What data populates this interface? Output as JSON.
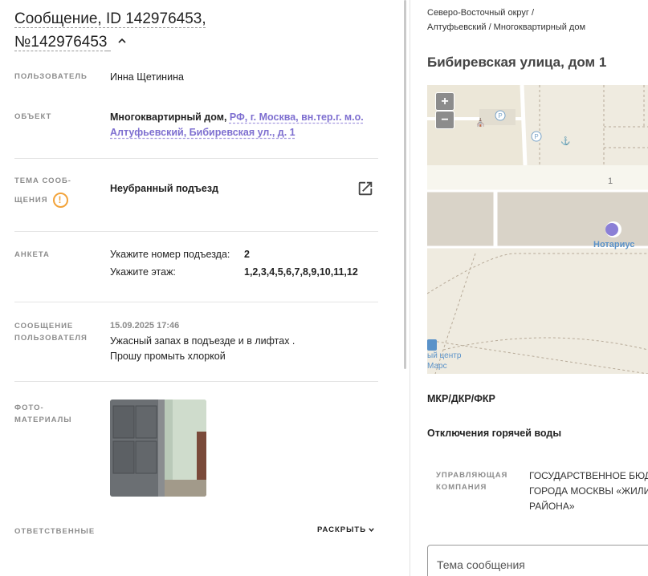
{
  "message": {
    "title_line1": "Сообщение, ID 142976453,",
    "title_line2": "№142976453"
  },
  "fields": {
    "user_label": "ПОЛЬЗОВАТЕЛЬ",
    "user_value": "Инна Щетинина",
    "object_label": "ОБЪЕКТ",
    "object_type": "Многоквартирный дом,",
    "object_link": "РФ, г. Москва, вн.тер.г. м.о. Алтуфьевский, Бибиревская ул., д. 1",
    "topic_label_1": "ТЕМА СООБ-",
    "topic_label_2": "ЩЕНИЯ",
    "topic_value": "Неубранный подъезд",
    "anketa_label": "АНКЕТА",
    "anketa": [
      {
        "q": "Укажите номер подъезда:",
        "a": "2"
      },
      {
        "q": "Укажите этаж:",
        "a": "1,2,3,4,5,6,7,8,9,10,11,12"
      }
    ],
    "user_msg_label_1": "СООБЩЕНИЕ",
    "user_msg_label_2": "ПОЛЬЗОВАТЕЛЯ",
    "user_msg_date": "15.09.2025 17:46",
    "user_msg_line1": "Ужасный запах в подъезде и в лифтах .",
    "user_msg_line2": "Прошу промыть хлоркой",
    "photo_label_1": "ФОТО-",
    "photo_label_2": "МАТЕРИАЛЫ",
    "responsible_label": "ОТВЕТСТВЕННЫЕ",
    "expand_label": "РАСКРЫТЬ"
  },
  "right": {
    "breadcrumb_line1": "Северо-Восточный округ /",
    "breadcrumb_line2": "Алтуфьевский / Многоквартирный дом",
    "address": "Бибиревская улица, дом 1",
    "map": {
      "zoom_in": "+",
      "zoom_out": "−",
      "house_number": "1",
      "poi_notary": "Нотариус",
      "poi_center": "ый центр",
      "poi_mars": "Марс",
      "parking": "P",
      "poi_color": "#8b7fd6"
    },
    "mkr": "МКР/ДКР/ФКР",
    "hot_water": "Отключения горячей воды",
    "uk_label_1": "УПРАВЛЯЮЩАЯ",
    "uk_label_2": "КОМПАНИЯ",
    "uk_value_1": "ГОСУДАРСТВЕННОЕ БЮД",
    "uk_value_2": "ГОРОДА МОСКВЫ «ЖИЛИ",
    "uk_value_3": "РАЙОНА»",
    "theme_placeholder": "Тема сообщения"
  },
  "colors": {
    "link": "#7e6fd0",
    "warning": "#f2a33a"
  }
}
